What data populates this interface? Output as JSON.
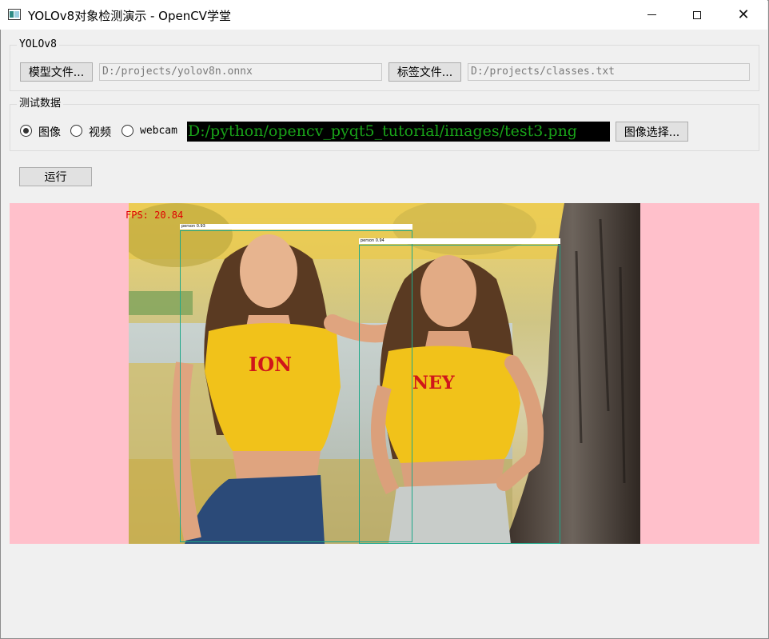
{
  "window": {
    "title": "YOLOv8对象检测演示 - OpenCV学堂"
  },
  "model_group": {
    "title": "YOLOv8",
    "model_button": "模型文件...",
    "model_path": "D:/projects/yolov8n.onnx",
    "label_button": "标签文件...",
    "label_path": "D:/projects/classes.txt"
  },
  "test_group": {
    "title": "测试数据",
    "options": [
      {
        "label": "图像",
        "checked": true
      },
      {
        "label": "视频",
        "checked": false
      },
      {
        "label": "webcam",
        "checked": false
      }
    ],
    "image_path": "D:/python/opencv_pyqt5_tutorial/images/test3.png",
    "select_button": "图像选择..."
  },
  "run_button": "运行",
  "display": {
    "fps_text": "FPS: 20.84",
    "background_color": "#ffc0cb",
    "box_color": "#1fa88a",
    "detections": [
      {
        "label": "person 0.93"
      },
      {
        "label": "person 0.94"
      }
    ]
  }
}
